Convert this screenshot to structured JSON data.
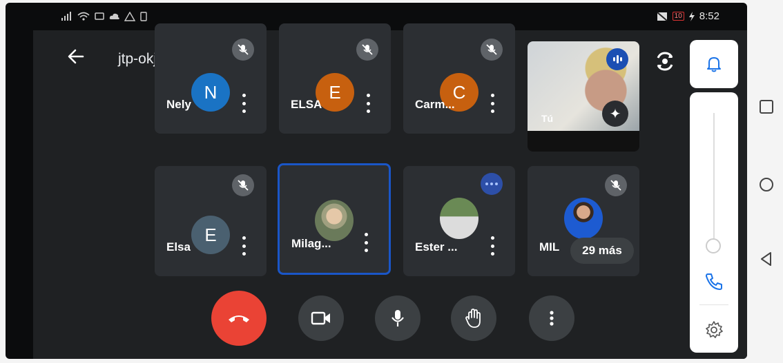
{
  "status_bar": {
    "left_icons": [
      "signal-icon",
      "wifi-icon",
      "cast-icon",
      "cloud-icon",
      "warning-icon",
      "sim-icon"
    ],
    "battery_level": "10",
    "time": "8:52"
  },
  "header": {
    "meeting_code": "jtp-okju-kpg",
    "back_icon": "arrow-left-icon",
    "switch_camera_icon": "switch-camera-icon"
  },
  "participants": [
    {
      "name": "Nely",
      "initial": "N",
      "color": "#1a73c4",
      "muted": true
    },
    {
      "name": "ELSA",
      "initial": "E",
      "color": "#c7600f",
      "muted": true
    },
    {
      "name": "Carm...",
      "initial": "C",
      "color": "#c7600f",
      "muted": true
    },
    {
      "name": "Elsa",
      "initial": "E",
      "color": "#4a6070",
      "muted": true
    },
    {
      "name": "Milag...",
      "photo": true,
      "selected": true
    },
    {
      "name": "Ester ...",
      "photo": true,
      "typing": true
    },
    {
      "name": "MIL",
      "photo": true,
      "muted": true
    }
  ],
  "self_view": {
    "name": "Tú"
  },
  "more_participants": "29 más",
  "controls": {
    "end_call": "end-call-icon",
    "camera": "video-camera-icon",
    "microphone": "microphone-icon",
    "raise_hand": "raise-hand-icon",
    "more": "more-vertical-icon"
  },
  "volume_panel": {
    "level": 0.1,
    "icons": [
      "bell-icon",
      "phone-icon",
      "gear-icon"
    ]
  },
  "system_nav": [
    "recents-icon",
    "home-icon",
    "back-icon"
  ]
}
